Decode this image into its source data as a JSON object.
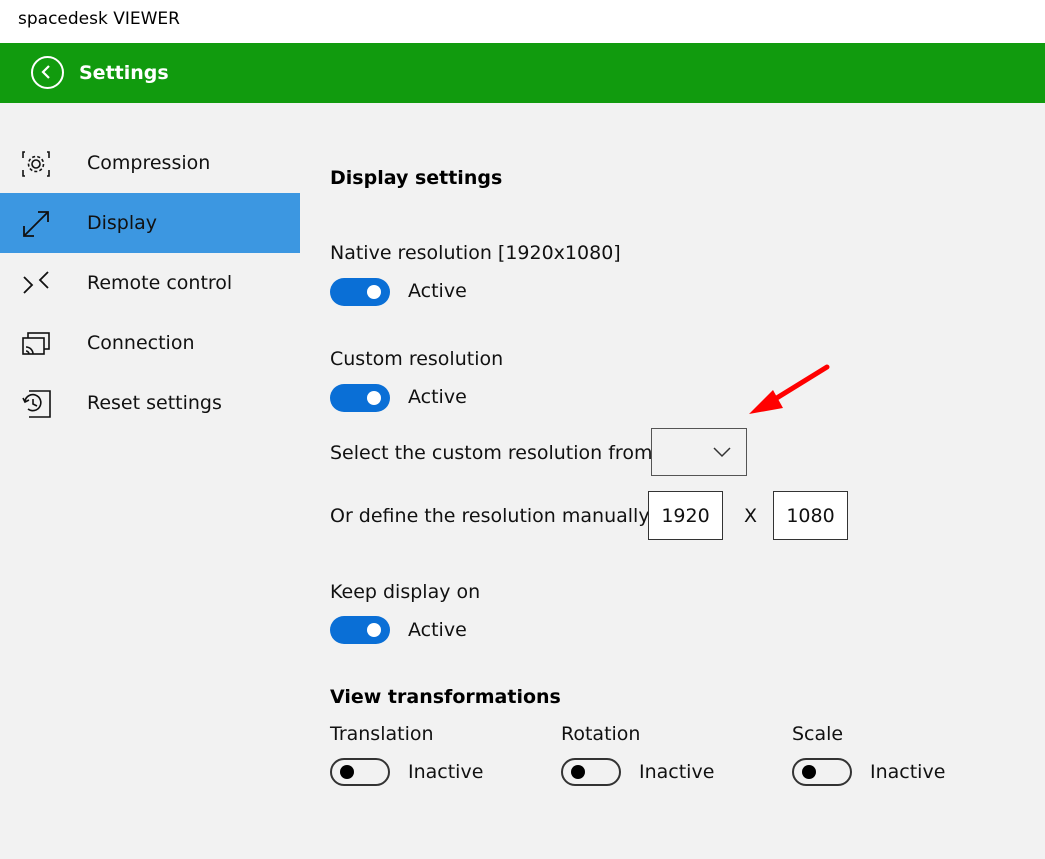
{
  "window": {
    "title": "spacedesk VIEWER"
  },
  "header": {
    "title": "Settings",
    "back_icon": "chevron-left-circle-icon",
    "color": "#119b0e"
  },
  "sidebar": {
    "active_color": "#3c97e1",
    "items": [
      {
        "label": "Compression",
        "icon": "compression-gear-icon"
      },
      {
        "label": "Display",
        "icon": "resize-diagonal-icon",
        "active": true
      },
      {
        "label": "Remote control",
        "icon": "remote-control-icon"
      },
      {
        "label": "Connection",
        "icon": "cast-screen-icon"
      },
      {
        "label": "Reset settings",
        "icon": "reset-history-icon"
      }
    ]
  },
  "display": {
    "heading": "Display settings",
    "native": {
      "label": "Native resolution [1920x1080]",
      "state": "Active"
    },
    "custom": {
      "label": "Custom resolution",
      "state": "Active",
      "select_label": "Select the custom resolution from",
      "select_value": "",
      "manual_label": "Or define the resolution manually",
      "width": "1920",
      "separator": "X",
      "height": "1080"
    },
    "keep_on": {
      "label": "Keep display on",
      "state": "Active"
    },
    "transform": {
      "heading": "View transformations",
      "translation": {
        "label": "Translation",
        "state": "Inactive"
      },
      "rotation": {
        "label": "Rotation",
        "state": "Inactive"
      },
      "scale": {
        "label": "Scale",
        "state": "Inactive"
      }
    }
  },
  "colors": {
    "toggle_on": "#0a6fd6",
    "annotation_arrow": "#ff0000"
  }
}
